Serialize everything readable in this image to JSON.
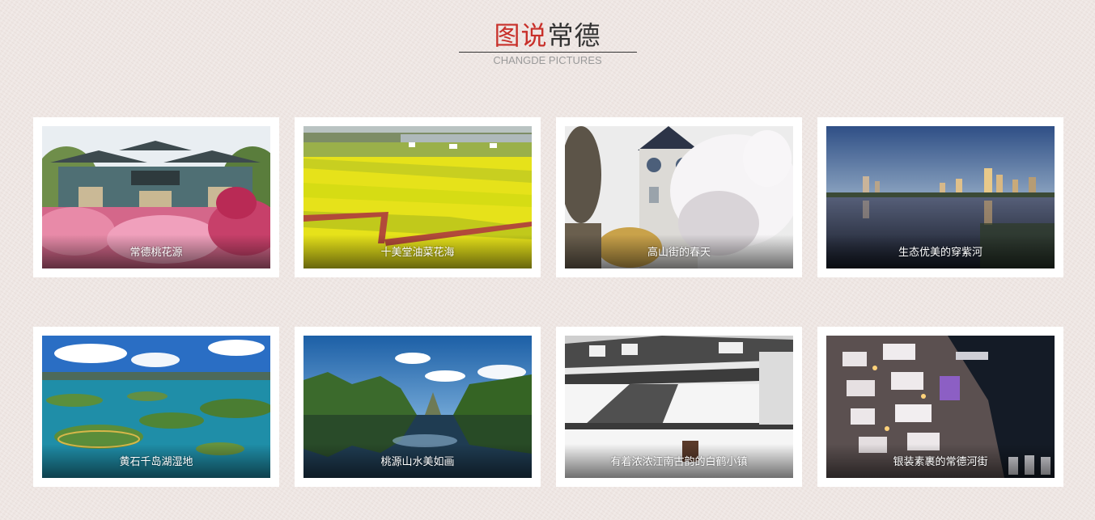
{
  "header": {
    "title_accent": "图说",
    "title_rest": "常德",
    "subtitle": "CHANGDE PICTURES",
    "accent_color": "#c8302a"
  },
  "gallery": {
    "items": [
      {
        "caption": "常德桃花源",
        "scene": "archway-peach-blossom"
      },
      {
        "caption": "十美堂油菜花海",
        "scene": "rapeseed-fields"
      },
      {
        "caption": "高山街的春天",
        "scene": "clock-tower-blossom"
      },
      {
        "caption": "生态优美的穿紫河",
        "scene": "river-skyline"
      },
      {
        "caption": "黄石千岛湖湿地",
        "scene": "lake-islands"
      },
      {
        "caption": "桃源山水美如画",
        "scene": "karst-reflection"
      },
      {
        "caption": "有着浓浓江南古韵的白鹤小镇",
        "scene": "white-walled-town"
      },
      {
        "caption": "银装素裹的常德河街",
        "scene": "snowy-river-street"
      }
    ]
  }
}
